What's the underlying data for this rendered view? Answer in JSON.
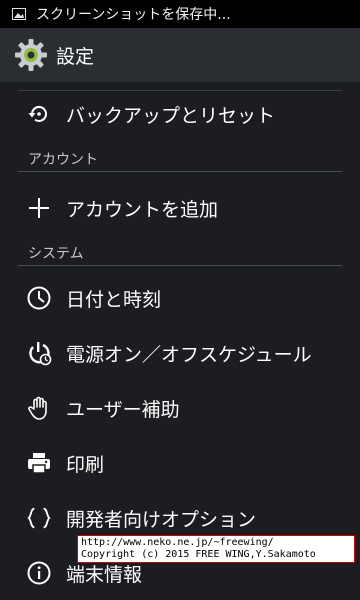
{
  "status_bar": {
    "notification_text": "スクリーンショットを保存中..."
  },
  "action_bar": {
    "title": "設定"
  },
  "items": [
    {
      "label": "バックアップとリセット",
      "icon": "backup-restore-icon"
    },
    {
      "label": "アカウントを追加",
      "icon": "add-icon"
    },
    {
      "label": "日付と時刻",
      "icon": "clock-icon"
    },
    {
      "label": "電源オン／オフスケジュール",
      "icon": "power-schedule-icon"
    },
    {
      "label": "ユーザー補助",
      "icon": "hand-icon"
    },
    {
      "label": "印刷",
      "icon": "printer-icon"
    },
    {
      "label": "開発者向けオプション",
      "icon": "braces-icon"
    },
    {
      "label": "端末情報",
      "icon": "info-icon"
    }
  ],
  "sections": {
    "account": "アカウント",
    "system": "システム"
  },
  "watermark": {
    "line1": "http://www.neko.ne.jp/~freewing/",
    "line2": "Copyright (c) 2015 FREE WING,Y.Sakamoto"
  },
  "colors": {
    "background": "#1b1d20",
    "action_bar": "#2a2d31",
    "status_bar": "#000000",
    "gear_accent": "#8fbf3f"
  }
}
